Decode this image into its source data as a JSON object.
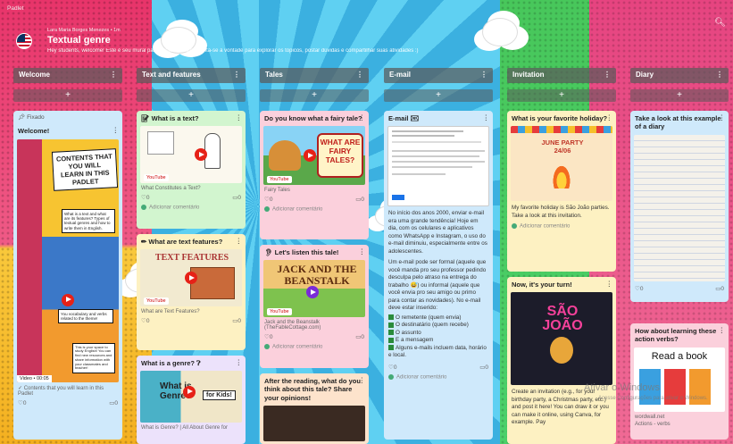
{
  "app_name": "Padlet",
  "header": {
    "author": "Lara Maria Borges Menezes • 1m",
    "title": "Textual genre",
    "description": "Hey students, welcome! Este é seu mural para aulas de Inglês. Sinta-se à vontade para explorar os tópicos, postar dúvidas e compartilhar suas atividades :)"
  },
  "columns": [
    {
      "label": "Welcome"
    },
    {
      "label": "Text and features"
    },
    {
      "label": "Tales"
    },
    {
      "label": "E-mail"
    },
    {
      "label": "Invitation"
    },
    {
      "label": "Diary"
    }
  ],
  "add_label": "+",
  "menu_glyph": "⋮",
  "welcome": {
    "pinned": "Fixado",
    "title": "Welcome!",
    "poster_heading": "CONTENTS THAT YOU WILL LEARN IN THIS PADLET",
    "poster_lines": [
      "What is a text and what are its features? Types of textual genres and how to write them in English.",
      "You vocabulary and verbs related to the theme!",
      "This is your space to study English! You can find new resources and share information with your classmates and teacher!"
    ],
    "video_label": "Video • 00:05",
    "caption": "Contents that you will learn in this Padlet",
    "likes": "0",
    "comments": "0"
  },
  "text_features": {
    "card1_title": "What is a text?",
    "card1_sub": "What Constitutes a Text?",
    "card2_title": "What are text features?",
    "card2_banner": "TEXT FEATURES",
    "card2_sub": "What are Text Features?",
    "card3_title": "What is a genre?",
    "card3_thumb_text": "What is Genre?",
    "card3_badge": "for Kids!",
    "card3_sub": "What is Genre? | All About Genre for"
  },
  "tales": {
    "card1_title": "Do you know what a fairy tale?",
    "card1_thumb": "WHAT ARE FAIRY TALES?",
    "card1_sub": "Fairy Tales",
    "card2_title": "Let's listen this tale!",
    "card2_thumb": "JACK AND THE BEANSTALK",
    "card2_sub": "Jack and the Beanstalk (TheFableCottage.com)",
    "card3_title": "After the reading, what do you think about this tale? Share your opinions!"
  },
  "email": {
    "title": "E-mail",
    "body": "No início dos anos 2000, enviar e-mail era uma grande tendência! Hoje em dia, com os celulares e aplicativos como WhatsApp e Instagram, o uso do e-mail diminuiu, especialmente entre os adolescentes.",
    "body2": "Um e-mail pode ser formal (aquele que você manda pro seu professor pedindo desculpa pelo atraso na entrega do trabalho 😅) ou informal (aquele que você envia pro seu amigo ou primo para contar as novidades). No e-mail deve estar inserido:",
    "items": [
      "O remetente (quem envia)",
      "O destinatário (quem recebe)",
      "O assunto",
      "E a mensagem",
      "Alguns e-mails incluem data, horário e local."
    ]
  },
  "invitation": {
    "card1_title": "What is your favorite holiday?",
    "card1_thumb": "JUNE PARTY 24/06",
    "card1_body": "My favorite holiday is São João parties. Take a look at this invitation.",
    "card2_title": "Now, it's your turn!",
    "card2_thumb": "SÃO JOÃO",
    "card2_body": "Create an invitation (e.g., for your birthday party, a Christmas party, etc.) and post it here! You can draw it or you can make it online, using Canva, for example. Pay"
  },
  "diary": {
    "card1_title": "Take a look at this example of a diary",
    "card2_title": "How about learning these action verbs?",
    "card2_thumb": "Read a book",
    "card2_sub": "wordwall.net",
    "card2_sub2": "Actions - verbs"
  },
  "common": {
    "youtube": "YouTube",
    "add_comment": "Adicionar comentário",
    "zero": "0"
  },
  "watermark": "Ativar o Windows",
  "watermark_sub": "Acesse Configurações para ativar o Windows."
}
